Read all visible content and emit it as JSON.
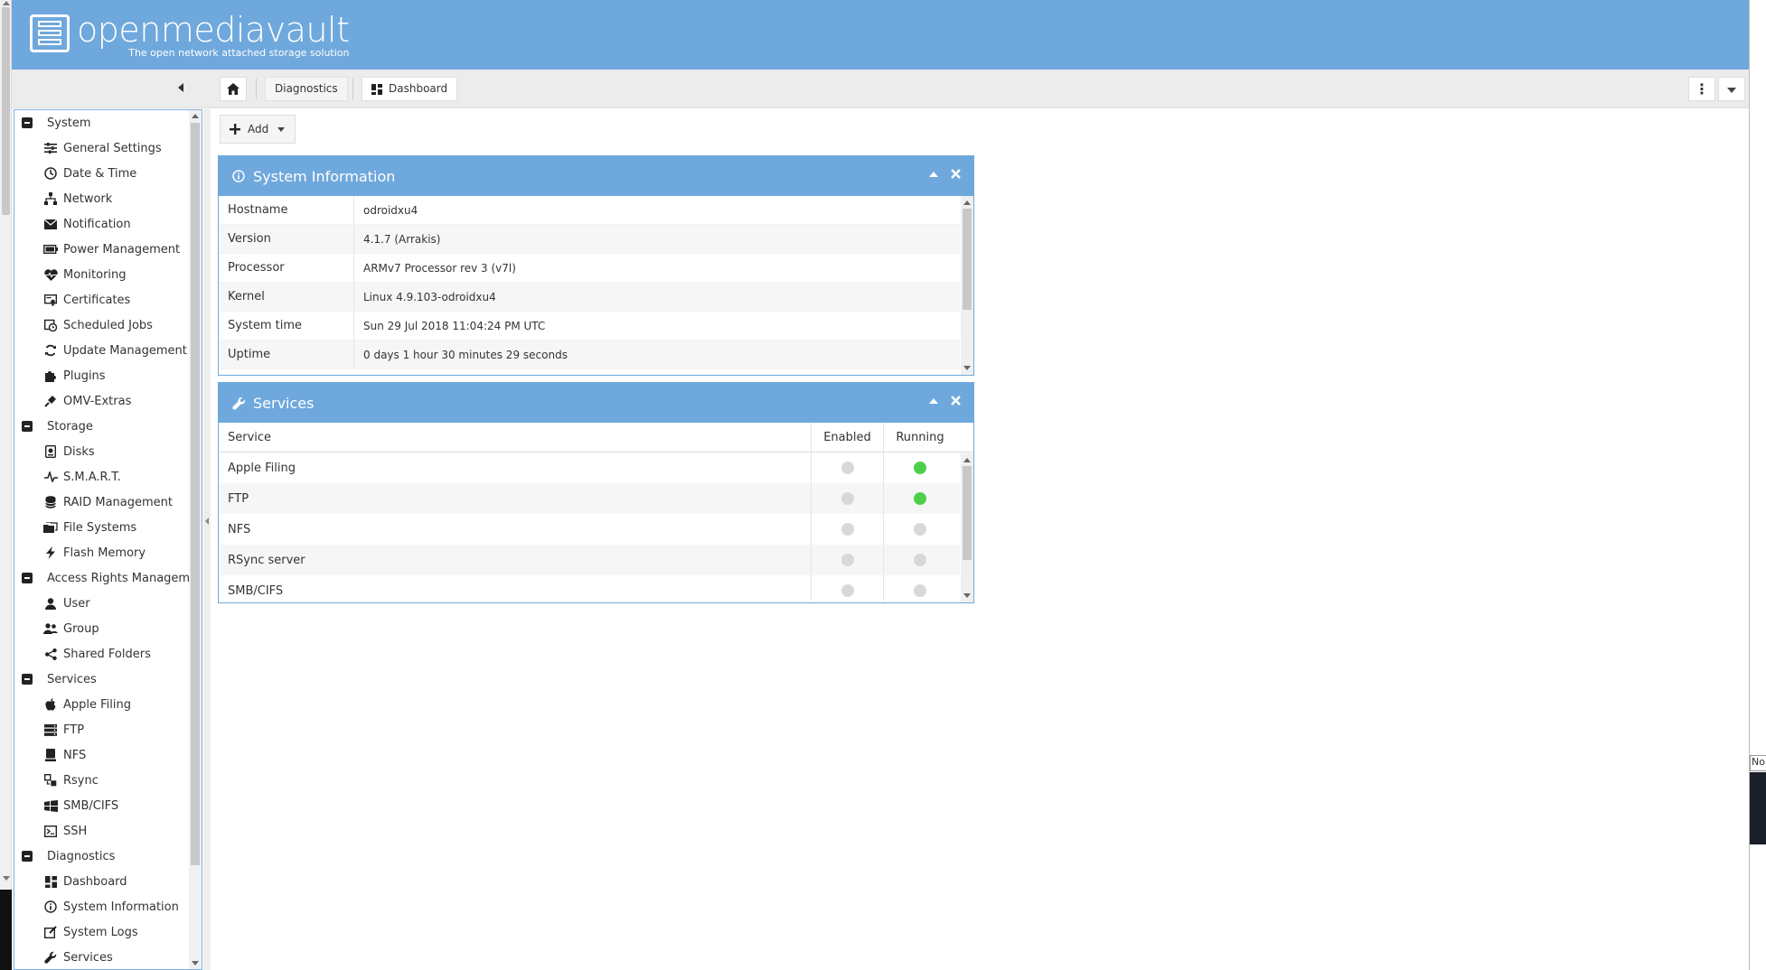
{
  "app": {
    "name": "openmediavault",
    "tagline": "The open network attached storage solution"
  },
  "breadcrumb": {
    "items": [
      "Diagnostics",
      "Dashboard"
    ]
  },
  "toolbar": {
    "add_label": "Add"
  },
  "sidebar": {
    "groups": [
      {
        "label": "System",
        "items": [
          {
            "label": "General Settings",
            "icon": "sliders-icon"
          },
          {
            "label": "Date & Time",
            "icon": "clock-icon"
          },
          {
            "label": "Network",
            "icon": "network-icon"
          },
          {
            "label": "Notification",
            "icon": "envelope-icon"
          },
          {
            "label": "Power Management",
            "icon": "battery-icon"
          },
          {
            "label": "Monitoring",
            "icon": "heartbeat-icon"
          },
          {
            "label": "Certificates",
            "icon": "certificate-icon"
          },
          {
            "label": "Scheduled Jobs",
            "icon": "calendar-clock-icon"
          },
          {
            "label": "Update Management",
            "icon": "refresh-icon"
          },
          {
            "label": "Plugins",
            "icon": "puzzle-icon"
          },
          {
            "label": "OMV-Extras",
            "icon": "plug-icon"
          }
        ]
      },
      {
        "label": "Storage",
        "items": [
          {
            "label": "Disks",
            "icon": "disk-icon"
          },
          {
            "label": "S.M.A.R.T.",
            "icon": "pulse-icon"
          },
          {
            "label": "RAID Management",
            "icon": "database-icon"
          },
          {
            "label": "File Systems",
            "icon": "folders-icon"
          },
          {
            "label": "Flash Memory",
            "icon": "flash-icon"
          }
        ]
      },
      {
        "label": "Access Rights Managemen",
        "items": [
          {
            "label": "User",
            "icon": "user-icon"
          },
          {
            "label": "Group",
            "icon": "users-icon"
          },
          {
            "label": "Shared Folders",
            "icon": "share-icon"
          }
        ]
      },
      {
        "label": "Services",
        "items": [
          {
            "label": "Apple Filing",
            "icon": "apple-icon"
          },
          {
            "label": "FTP",
            "icon": "ftp-icon"
          },
          {
            "label": "NFS",
            "icon": "server-icon"
          },
          {
            "label": "Rsync",
            "icon": "rsync-icon"
          },
          {
            "label": "SMB/CIFS",
            "icon": "windows-icon"
          },
          {
            "label": "SSH",
            "icon": "terminal-icon"
          }
        ]
      },
      {
        "label": "Diagnostics",
        "items": [
          {
            "label": "Dashboard",
            "icon": "dashboard-icon"
          },
          {
            "label": "System Information",
            "icon": "info-icon"
          },
          {
            "label": "System Logs",
            "icon": "edit-icon"
          },
          {
            "label": "Services",
            "icon": "wrench-icon"
          }
        ]
      }
    ]
  },
  "system_info": {
    "title": "System Information",
    "rows": [
      {
        "key": "Hostname",
        "value": "odroidxu4"
      },
      {
        "key": "Version",
        "value": "4.1.7 (Arrakis)"
      },
      {
        "key": "Processor",
        "value": "ARMv7 Processor rev 3 (v7l)"
      },
      {
        "key": "Kernel",
        "value": "Linux 4.9.103-odroidxu4"
      },
      {
        "key": "System time",
        "value": "Sun 29 Jul 2018 11:04:24 PM UTC"
      },
      {
        "key": "Uptime",
        "value": "0 days 1 hour 30 minutes 29 seconds"
      }
    ]
  },
  "services": {
    "title": "Services",
    "columns": [
      "Service",
      "Enabled",
      "Running"
    ],
    "rows": [
      {
        "name": "Apple Filing",
        "enabled": false,
        "running": true
      },
      {
        "name": "FTP",
        "enabled": false,
        "running": true
      },
      {
        "name": "NFS",
        "enabled": false,
        "running": false
      },
      {
        "name": "RSync server",
        "enabled": false,
        "running": false
      },
      {
        "name": "SMB/CIFS",
        "enabled": false,
        "running": false
      }
    ]
  },
  "right_edge": {
    "label": "No"
  },
  "colors": {
    "accent": "#6fa8dc",
    "status_on": "#4cd04c",
    "status_off": "#d8d8d8"
  }
}
